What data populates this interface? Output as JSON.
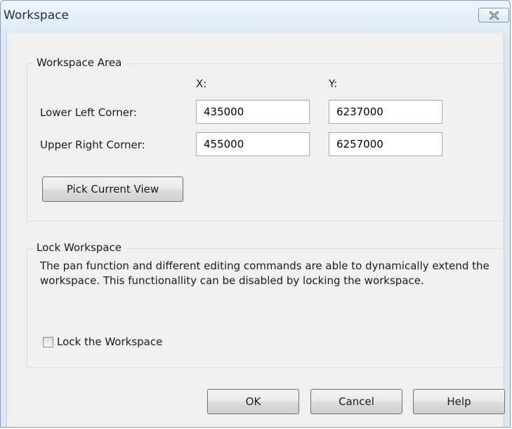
{
  "window": {
    "title": "Workspace"
  },
  "workspace_area": {
    "title": "Workspace Area",
    "col_x_label": "X:",
    "col_y_label": "Y:",
    "lower_left": {
      "label": "Lower Left Corner:",
      "x": "435000",
      "y": "6237000"
    },
    "upper_right": {
      "label": "Upper Right Corner:",
      "x": "455000",
      "y": "6257000"
    },
    "pick_button": "Pick Current View"
  },
  "lock_workspace": {
    "title": "Lock Workspace",
    "description": "The pan function and different editing commands are able to dynamically extend the workspace. This functionallity can be disabled by locking the workspace.",
    "checkbox_label": "Lock the Workspace",
    "checked": false
  },
  "buttons": {
    "ok": "OK",
    "cancel": "Cancel",
    "help": "Help"
  },
  "icons": {
    "close": "close-icon"
  }
}
